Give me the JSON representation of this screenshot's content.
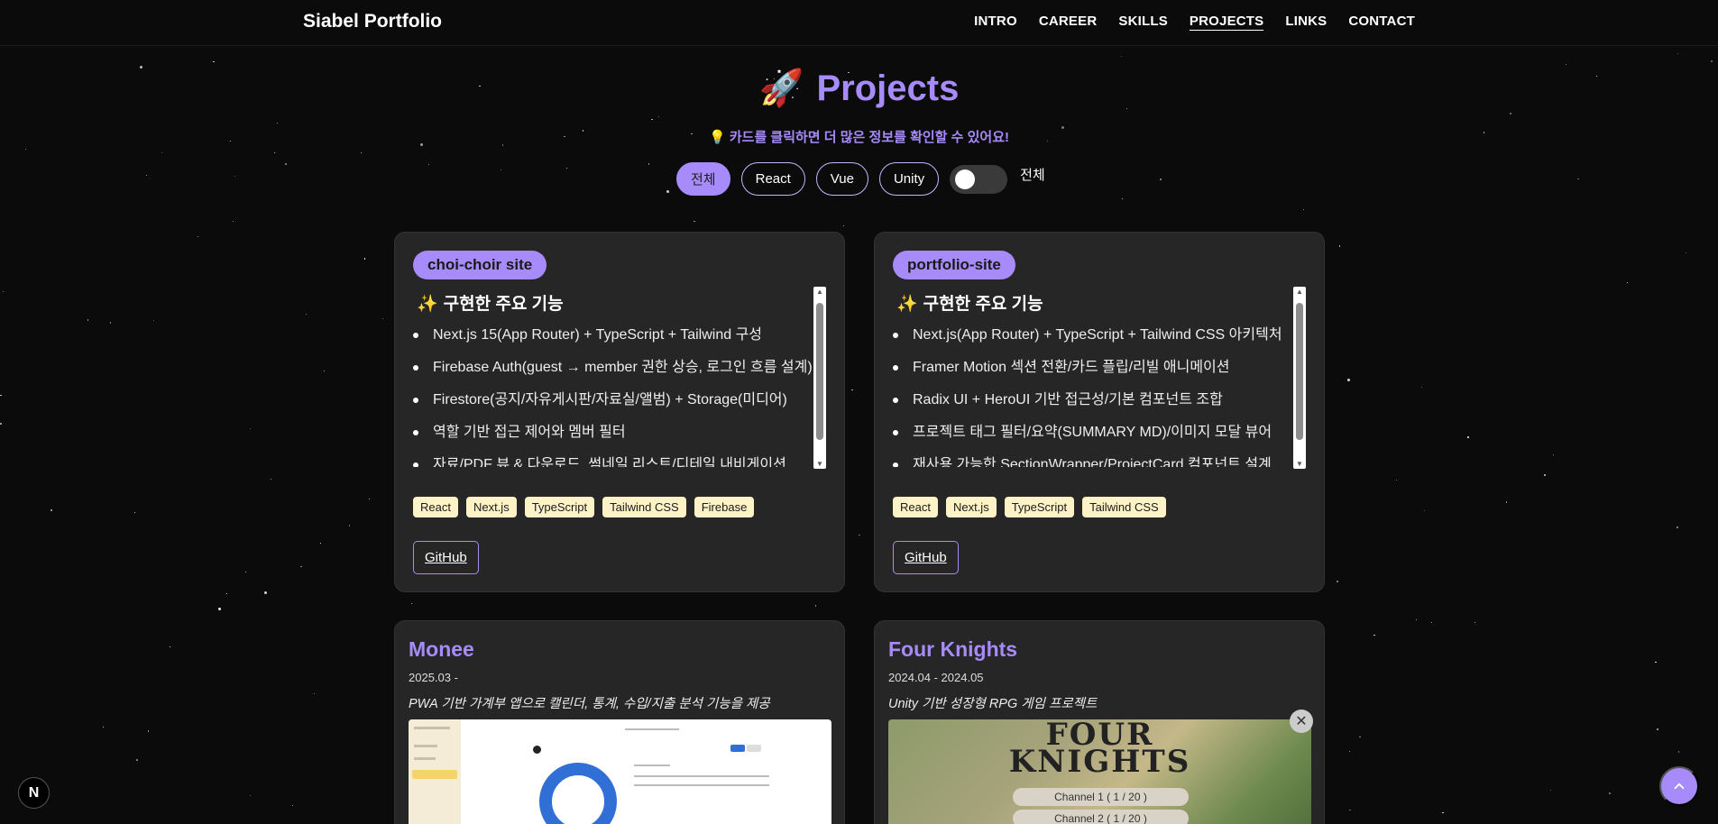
{
  "nav": {
    "brand": "Siabel Portfolio",
    "items": [
      {
        "label": "INTRO",
        "active": false
      },
      {
        "label": "CAREER",
        "active": false
      },
      {
        "label": "SKILLS",
        "active": false
      },
      {
        "label": "PROJECTS",
        "active": true
      },
      {
        "label": "LINKS",
        "active": false
      },
      {
        "label": "CONTACT",
        "active": false
      }
    ]
  },
  "section": {
    "icon": "rocket-icon",
    "title": "Projects",
    "hint_icon": "lightbulb-icon",
    "hint": "카드를 클릭하면 더 많은 정보를 확인할 수 있어요!"
  },
  "filters": {
    "options": [
      {
        "label": "전체",
        "active": true
      },
      {
        "label": "React",
        "active": false
      },
      {
        "label": "Vue",
        "active": false
      },
      {
        "label": "Unity",
        "active": false
      }
    ],
    "toggle_label": "전체",
    "toggle_on": false
  },
  "flipped_cards": [
    {
      "badge": "choi-choir site",
      "features_title": "구현한 주요 기능",
      "features": [
        "Next.js 15(App Router) + TypeScript + Tailwind 구성",
        "Firebase Auth(guest → member 권한 상승, 로그인 흐름 설계)",
        "Firestore(공지/자유게시판/자료실/앨범) + Storage(미디어)",
        "역할 기반 접근 제어와 멤버 필터",
        "자료/PDF 뷰 & 다운로드, 썸네일 리스트/디테일 내비게이션"
      ],
      "tags": [
        "React",
        "Next.js",
        "TypeScript",
        "Tailwind CSS",
        "Firebase"
      ],
      "link_label": "GitHub"
    },
    {
      "badge": "portfolio-site",
      "features_title": "구현한 주요 기능",
      "features": [
        "Next.js(App Router) + TypeScript + Tailwind CSS 아키텍처",
        "Framer Motion 섹션 전환/카드 플립/리빌 애니메이션",
        "Radix UI + HeroUI 기반 접근성/기본 컴포넌트 조합",
        "프로젝트 태그 필터/요약(SUMMARY MD)/이미지 모달 뷰어",
        "재사용 가능한 SectionWrapper/ProjectCard 컴포넌트 설계"
      ],
      "tags": [
        "React",
        "Next.js",
        "TypeScript",
        "Tailwind CSS"
      ],
      "link_label": "GitHub"
    }
  ],
  "info_cards": [
    {
      "title": "Monee",
      "date": "2025.03 -",
      "description": "PWA 기반 가계부 앱으로 캘린더, 통계, 수입/지출 분석 기능을 제공"
    },
    {
      "title": "Four Knights",
      "date": "2024.04 - 2024.05",
      "description": "Unity 기반 성장형 RPG 게임 프로젝트",
      "image_text": {
        "logo_line1": "FOUR",
        "logo_line2": "KNIGHTS",
        "channels": [
          "Channel 1 ( 1 / 20 )",
          "Channel 2 ( 1 / 20 )"
        ]
      }
    }
  ],
  "floating": {
    "next_badge": "N",
    "scroll_top_icon": "arrow-up-icon",
    "close_icon": "close-icon"
  },
  "colors": {
    "background": "#0b0b0b",
    "accent": "#a78bfa",
    "card": "#262626",
    "tag": "#fef3c7"
  }
}
